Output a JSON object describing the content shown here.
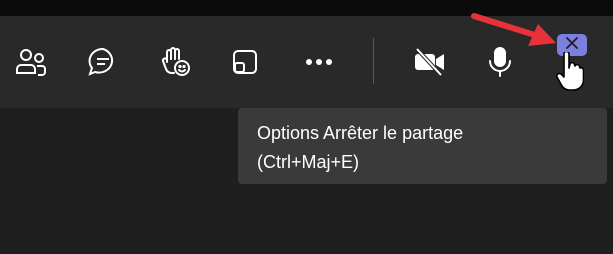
{
  "toolbar": {
    "buttons": [
      {
        "name": "people",
        "icon": "people-icon"
      },
      {
        "name": "chat",
        "icon": "chat-icon"
      },
      {
        "name": "raise-hand",
        "icon": "raise-hand-icon"
      },
      {
        "name": "view",
        "icon": "view-icon"
      },
      {
        "name": "more",
        "icon": "more-icon"
      },
      {
        "name": "camera",
        "icon": "camera-off-icon"
      },
      {
        "name": "mic",
        "icon": "mic-icon"
      }
    ],
    "stop_share": {
      "icon": "close-icon",
      "color": "#7b7fe0"
    }
  },
  "tooltip": {
    "line1": "Options Arrêter le partage",
    "line2": "(Ctrl+Maj+E)"
  },
  "colors": {
    "background": "#1f1f1f",
    "toolbar": "#292929",
    "tooltip": "#3a3a3a",
    "accent": "#7b7fe0",
    "annotation_arrow": "#e8323a"
  }
}
